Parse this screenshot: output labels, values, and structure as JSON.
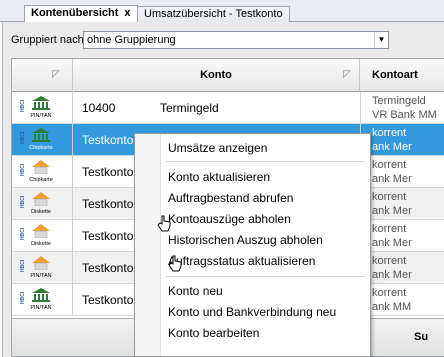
{
  "tabs": [
    {
      "label": "Kontenübersicht",
      "close": "x"
    },
    {
      "label": "Umsatzübersicht - Testkonto"
    }
  ],
  "grouping": {
    "label": "Gruppiert nach",
    "value": "ohne Gruppierung"
  },
  "columns": {
    "konto": "Konto",
    "kontoart": "Kontoart"
  },
  "rows": [
    {
      "icon": "bank-icon",
      "badge": "PIN/TAN",
      "nr": "10400",
      "name": "Termingeld",
      "art1": "Termingeld",
      "art2": "VR Bank MM"
    },
    {
      "icon": "bank-icon",
      "badge": "Chipkarte",
      "nr": "Testkonto",
      "name": "",
      "art1": "korrent",
      "art2": "ank Mer"
    },
    {
      "icon": "house-icon",
      "badge": "Chipkarte",
      "nr": "Testkonto",
      "name": "",
      "art1": "korrent",
      "art2": "ank Mer"
    },
    {
      "icon": "house-icon",
      "badge": "Diskette",
      "nr": "Testkonto",
      "name": "",
      "art1": "korrent",
      "art2": "ank Mer"
    },
    {
      "icon": "house-icon",
      "badge": "Diskette",
      "nr": "Testkonto",
      "name": "",
      "art1": "korrent",
      "art2": "ank Mer"
    },
    {
      "icon": "house-icon",
      "badge": "PIN/TAN",
      "nr": "Testkonto",
      "name": "",
      "art1": "korrent",
      "art2": "ank Mer"
    },
    {
      "icon": "bank-icon",
      "badge": "PIN/TAN",
      "nr": "Testkonto",
      "name": "",
      "art1": "korrent",
      "art2": "ank MM"
    }
  ],
  "hbci_text": "HBCI",
  "footer_label": "Su",
  "menu": [
    "Umsätze anzeigen",
    "Konto aktualisieren",
    "Auftragbestand abrufen",
    "Kontoauszüge abholen",
    "Historischen Auszug abholen",
    "Auftragsstatus aktualisieren",
    "Konto neu",
    "Konto und Bankverbindung neu",
    "Konto bearbeiten"
  ],
  "colors": {
    "selection": "#3399dd",
    "bank_green": "#2e7d32",
    "house_orange": "#f0a030"
  }
}
